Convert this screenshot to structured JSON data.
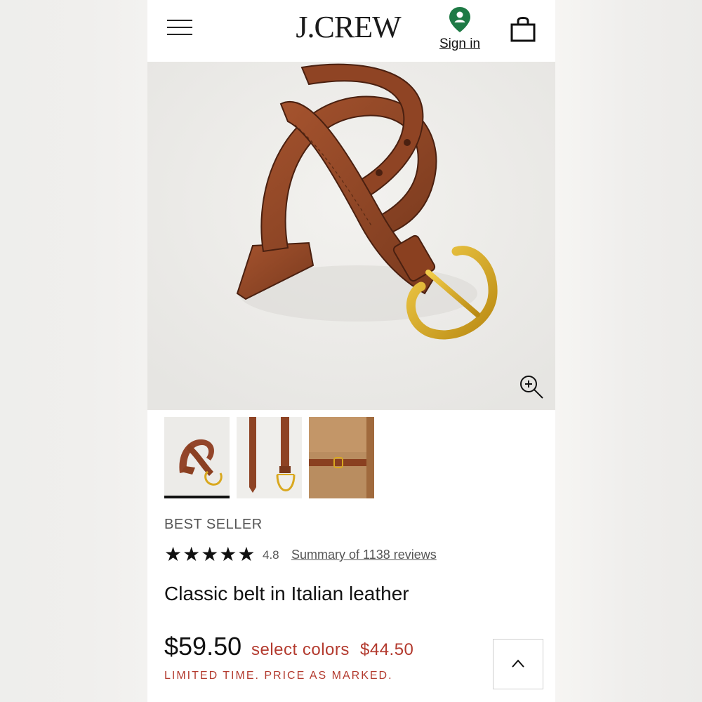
{
  "header": {
    "logo_text": "J.CREW",
    "sign_in_label": "Sign in"
  },
  "colors": {
    "accent_sale": "#b33a2e",
    "pin_green": "#1e7a45",
    "belt_brown": "#8c4426",
    "buckle_gold": "#d9a81f"
  },
  "icons": {
    "menu": "hamburger-icon",
    "location": "map-pin-icon",
    "bag": "shopping-bag-icon",
    "zoom": "zoom-in-icon",
    "back_to_top": "chevron-up-icon"
  },
  "gallery": {
    "thumbnails": [
      {
        "label": "coiled belt",
        "active": true
      },
      {
        "label": "belt flat",
        "active": false
      },
      {
        "label": "belt worn",
        "active": false
      }
    ]
  },
  "product": {
    "badge": "BEST SELLER",
    "stars": "★★★★★",
    "rating": "4.8",
    "reviews_link": "Summary of 1138 reviews",
    "title": "Classic belt in Italian leather",
    "price": "$59.50",
    "sale_label": "select colors",
    "sale_price": "$44.50",
    "promo": "LIMITED TIME. PRICE AS MARKED."
  }
}
